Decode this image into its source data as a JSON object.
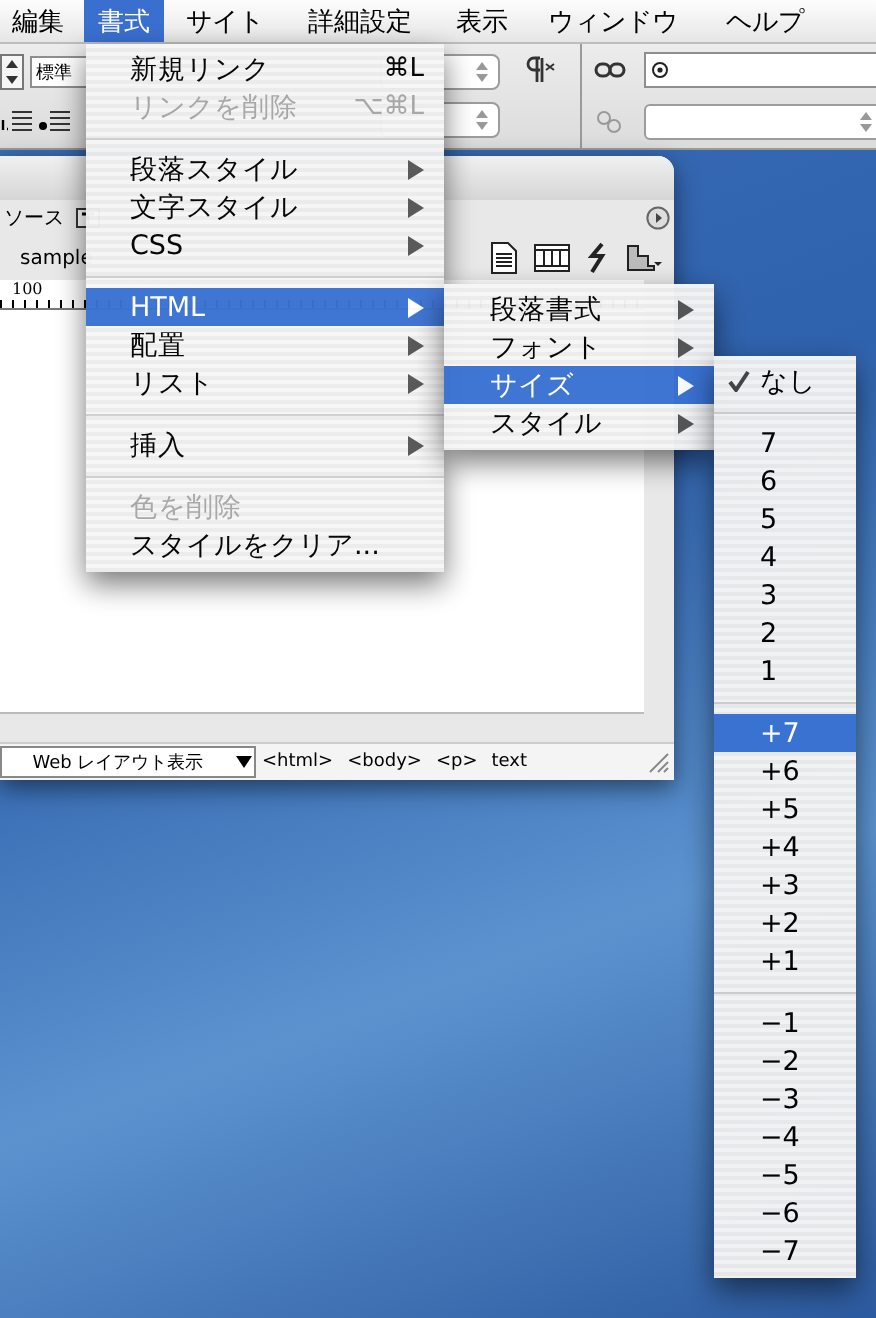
{
  "menu_bar": {
    "items": [
      {
        "label": "編集",
        "selected": false
      },
      {
        "label": "書式",
        "selected": true
      },
      {
        "label": "サイト",
        "selected": false
      },
      {
        "label": "詳細設定",
        "selected": false
      },
      {
        "label": "表示",
        "selected": false
      },
      {
        "label": "ウィンドウ",
        "selected": false
      },
      {
        "label": "ヘルプ",
        "selected": false
      }
    ]
  },
  "properties_bar": {
    "format_value": "標準"
  },
  "document_window": {
    "view_button": "ソース",
    "title_label": "sample",
    "ruler_mark": "100",
    "view_mode": "Web レイアウト表示",
    "tag_path": [
      "<html>",
      "<body>",
      "<p>",
      "text"
    ]
  },
  "format_menu": {
    "items": [
      {
        "kind": "item",
        "label": "新規リンク",
        "shortcut": "⌘L",
        "disabled": false,
        "selected": false,
        "submenu": false
      },
      {
        "kind": "item",
        "label": "リンクを削除",
        "shortcut": "⌥⌘L",
        "disabled": true,
        "selected": false,
        "submenu": false
      },
      {
        "kind": "separator"
      },
      {
        "kind": "item",
        "label": "段落スタイル",
        "disabled": false,
        "selected": false,
        "submenu": true
      },
      {
        "kind": "item",
        "label": "文字スタイル",
        "disabled": false,
        "selected": false,
        "submenu": true
      },
      {
        "kind": "item",
        "label": "CSS",
        "disabled": false,
        "selected": false,
        "submenu": true
      },
      {
        "kind": "separator"
      },
      {
        "kind": "item",
        "label": "HTML",
        "disabled": false,
        "selected": true,
        "submenu": true
      },
      {
        "kind": "item",
        "label": "配置",
        "disabled": false,
        "selected": false,
        "submenu": true
      },
      {
        "kind": "item",
        "label": "リスト",
        "disabled": false,
        "selected": false,
        "submenu": true
      },
      {
        "kind": "separator"
      },
      {
        "kind": "item",
        "label": "挿入",
        "disabled": false,
        "selected": false,
        "submenu": true
      },
      {
        "kind": "separator"
      },
      {
        "kind": "item",
        "label": "色を削除",
        "disabled": true,
        "selected": false,
        "submenu": false
      },
      {
        "kind": "item",
        "label": "スタイルをクリア...",
        "disabled": false,
        "selected": false,
        "submenu": false
      }
    ]
  },
  "html_submenu": {
    "items": [
      {
        "kind": "item",
        "label": "段落書式",
        "disabled": false,
        "selected": false,
        "submenu": true
      },
      {
        "kind": "item",
        "label": "フォント",
        "disabled": false,
        "selected": false,
        "submenu": true
      },
      {
        "kind": "item",
        "label": "サイズ",
        "disabled": false,
        "selected": true,
        "submenu": true
      },
      {
        "kind": "item",
        "label": "スタイル",
        "disabled": false,
        "selected": false,
        "submenu": true
      }
    ]
  },
  "size_submenu": {
    "items": [
      {
        "kind": "item",
        "label": "なし",
        "checked": true,
        "selected": false
      },
      {
        "kind": "separator"
      },
      {
        "kind": "item",
        "label": "7",
        "checked": false,
        "selected": false
      },
      {
        "kind": "item",
        "label": "6",
        "checked": false,
        "selected": false
      },
      {
        "kind": "item",
        "label": "5",
        "checked": false,
        "selected": false
      },
      {
        "kind": "item",
        "label": "4",
        "checked": false,
        "selected": false
      },
      {
        "kind": "item",
        "label": "3",
        "checked": false,
        "selected": false
      },
      {
        "kind": "item",
        "label": "2",
        "checked": false,
        "selected": false
      },
      {
        "kind": "item",
        "label": "1",
        "checked": false,
        "selected": false
      },
      {
        "kind": "separator"
      },
      {
        "kind": "item",
        "label": "+7",
        "checked": false,
        "selected": true
      },
      {
        "kind": "item",
        "label": "+6",
        "checked": false,
        "selected": false
      },
      {
        "kind": "item",
        "label": "+5",
        "checked": false,
        "selected": false
      },
      {
        "kind": "item",
        "label": "+4",
        "checked": false,
        "selected": false
      },
      {
        "kind": "item",
        "label": "+3",
        "checked": false,
        "selected": false
      },
      {
        "kind": "item",
        "label": "+2",
        "checked": false,
        "selected": false
      },
      {
        "kind": "item",
        "label": "+1",
        "checked": false,
        "selected": false
      },
      {
        "kind": "separator"
      },
      {
        "kind": "item",
        "label": "−1",
        "checked": false,
        "selected": false
      },
      {
        "kind": "item",
        "label": "−2",
        "checked": false,
        "selected": false
      },
      {
        "kind": "item",
        "label": "−3",
        "checked": false,
        "selected": false
      },
      {
        "kind": "item",
        "label": "−4",
        "checked": false,
        "selected": false
      },
      {
        "kind": "item",
        "label": "−5",
        "checked": false,
        "selected": false
      },
      {
        "kind": "item",
        "label": "−6",
        "checked": false,
        "selected": false
      },
      {
        "kind": "item",
        "label": "−7",
        "checked": false,
        "selected": false
      }
    ]
  }
}
